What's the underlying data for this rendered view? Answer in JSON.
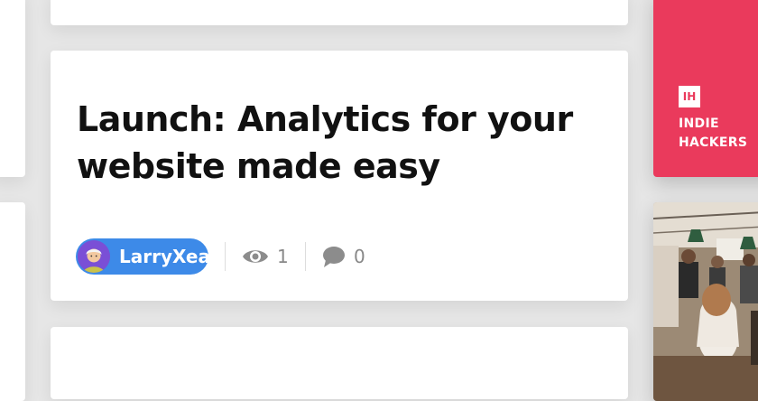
{
  "post": {
    "title": "Launch: Analytics for your website made easy",
    "author": "LarryXea",
    "views": "1",
    "comments": "0"
  },
  "sidebar_ad": {
    "logo_text": "IH",
    "line1": "INDIE",
    "line2": "HACKERS"
  },
  "colors": {
    "author_pill": "#3d8ae8",
    "brand_red": "#ea3a5c",
    "avatar_bg": "#7a4fd6"
  },
  "icons": {
    "views": "eye-icon",
    "comments": "comment-icon"
  }
}
